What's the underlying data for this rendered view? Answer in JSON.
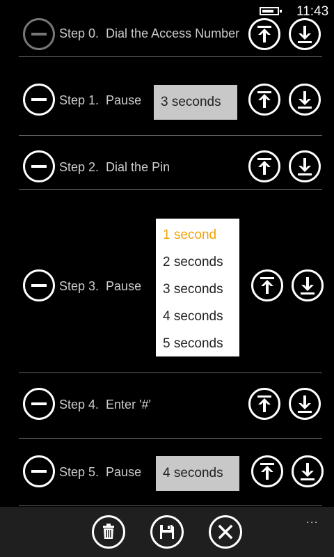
{
  "status": {
    "time": "11:43",
    "battery_level": 0.8
  },
  "steps": [
    {
      "label": "Step 0.  Dial the Access Number"
    },
    {
      "label": "Step 1.  Pause",
      "duration": "3 seconds"
    },
    {
      "label": "Step 2.  Dial the Pin"
    },
    {
      "label": "Step 3.  Pause"
    },
    {
      "label": "Step 4.  Enter '#'"
    },
    {
      "label": "Step 5.  Pause",
      "duration": "4 seconds"
    }
  ],
  "pause_options": [
    "1 second",
    "2 seconds",
    "3 seconds",
    "4 seconds",
    "5 seconds"
  ],
  "selected_option": "1 second",
  "app_bar": {
    "more": "...",
    "buttons": [
      "delete-icon",
      "save-icon",
      "close-icon"
    ]
  },
  "colors": {
    "accent": "#f0a30a",
    "background": "#000000",
    "field": "#c8c8c8"
  }
}
